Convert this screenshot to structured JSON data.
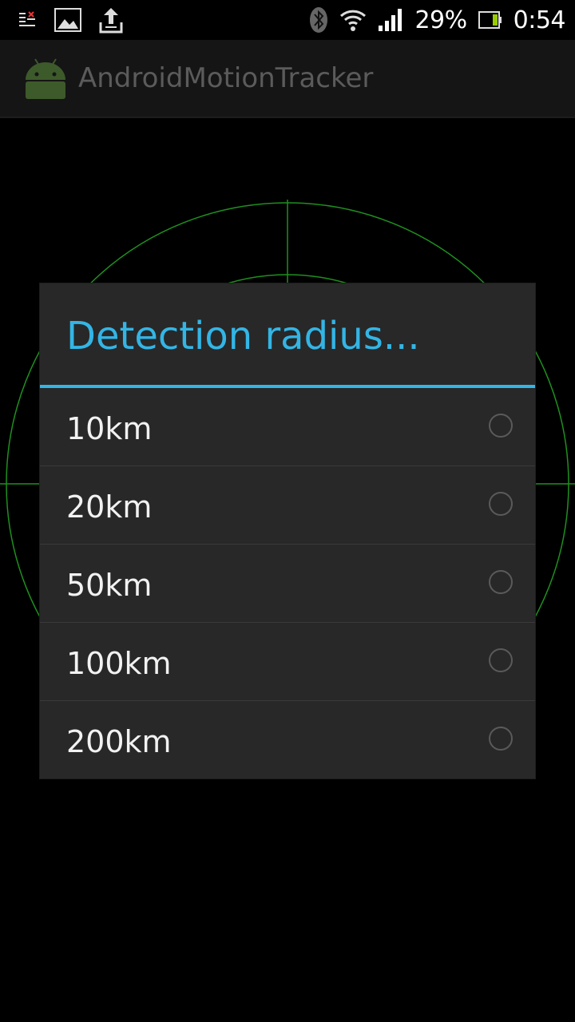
{
  "status_bar": {
    "battery_percent": "29%",
    "time": "0:54",
    "icons": [
      "notification-icon",
      "gallery-icon",
      "upload-icon",
      "bluetooth-icon",
      "wifi-icon",
      "signal-icon",
      "battery-icon"
    ]
  },
  "action_bar": {
    "app_title": "AndroidMotionTracker",
    "app_icon": "android-icon"
  },
  "dialog": {
    "title": "Detection radius...",
    "accent_color": "#33b5e5",
    "options": [
      {
        "label": "10km",
        "selected": false
      },
      {
        "label": "20km",
        "selected": false
      },
      {
        "label": "50km",
        "selected": false
      },
      {
        "label": "100km",
        "selected": false
      },
      {
        "label": "200km",
        "selected": false
      }
    ]
  },
  "radar": {
    "line_color": "#1f8f1f"
  }
}
